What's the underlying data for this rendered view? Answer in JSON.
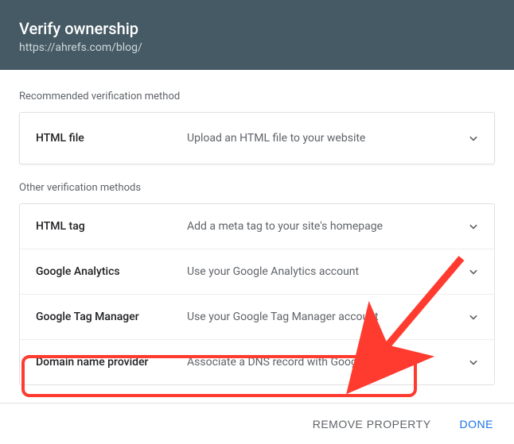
{
  "header": {
    "title": "Verify ownership",
    "subtitle": "https://ahrefs.com/blog/"
  },
  "recommended": {
    "section_label": "Recommended verification method",
    "item": {
      "title": "HTML file",
      "desc": "Upload an HTML file to your website"
    }
  },
  "other": {
    "section_label": "Other verification methods",
    "items": [
      {
        "title": "HTML tag",
        "desc": "Add a meta tag to your site's homepage"
      },
      {
        "title": "Google Analytics",
        "desc": "Use your Google Analytics account"
      },
      {
        "title": "Google Tag Manager",
        "desc": "Use your Google Tag Manager account"
      },
      {
        "title": "Domain name provider",
        "desc": "Associate a DNS record with Google"
      }
    ]
  },
  "footer": {
    "remove_label": "Remove Property",
    "done_label": "Done"
  },
  "annotation_color": "#ff3b30"
}
